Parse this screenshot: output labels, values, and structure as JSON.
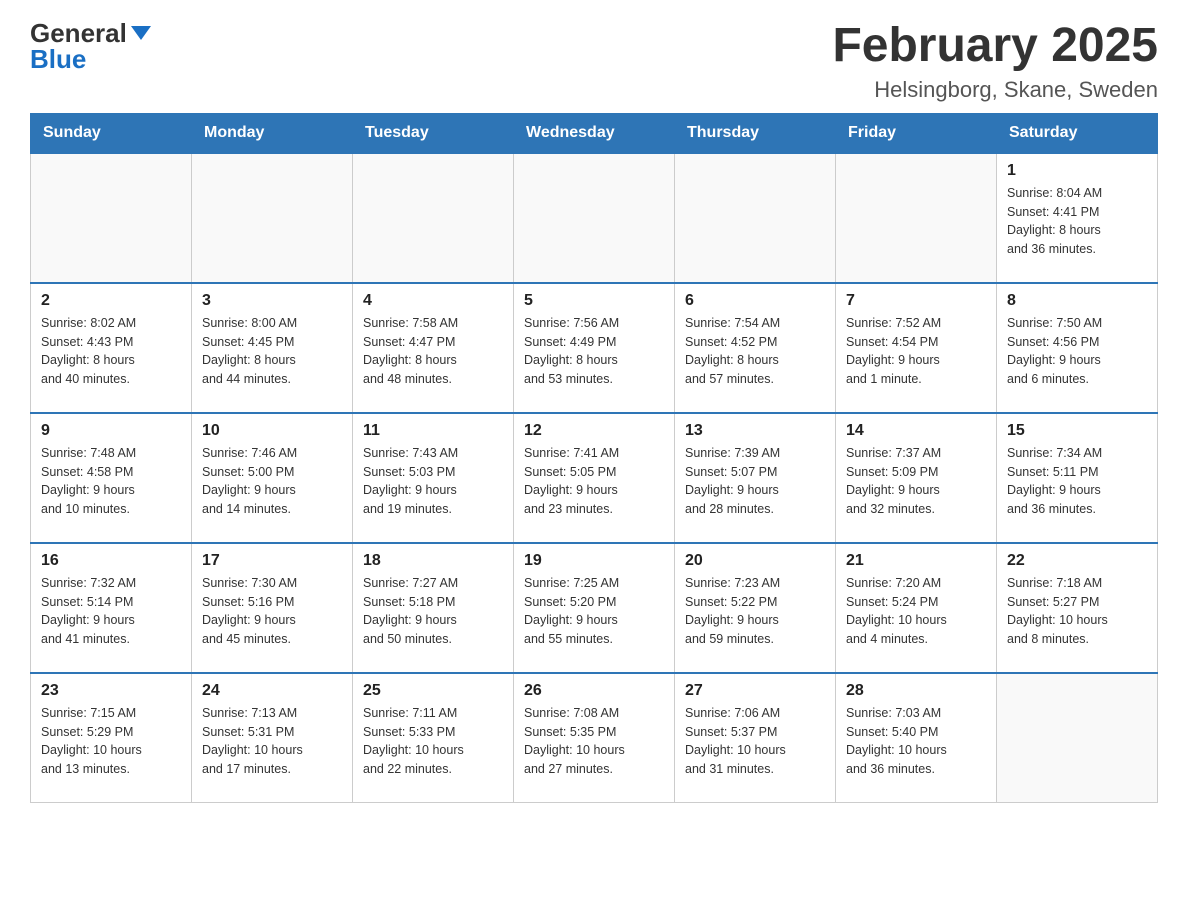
{
  "header": {
    "logo_general": "General",
    "logo_blue": "Blue",
    "month_title": "February 2025",
    "location": "Helsingborg, Skane, Sweden"
  },
  "weekdays": [
    "Sunday",
    "Monday",
    "Tuesday",
    "Wednesday",
    "Thursday",
    "Friday",
    "Saturday"
  ],
  "weeks": [
    [
      {
        "day": "",
        "info": ""
      },
      {
        "day": "",
        "info": ""
      },
      {
        "day": "",
        "info": ""
      },
      {
        "day": "",
        "info": ""
      },
      {
        "day": "",
        "info": ""
      },
      {
        "day": "",
        "info": ""
      },
      {
        "day": "1",
        "info": "Sunrise: 8:04 AM\nSunset: 4:41 PM\nDaylight: 8 hours\nand 36 minutes."
      }
    ],
    [
      {
        "day": "2",
        "info": "Sunrise: 8:02 AM\nSunset: 4:43 PM\nDaylight: 8 hours\nand 40 minutes."
      },
      {
        "day": "3",
        "info": "Sunrise: 8:00 AM\nSunset: 4:45 PM\nDaylight: 8 hours\nand 44 minutes."
      },
      {
        "day": "4",
        "info": "Sunrise: 7:58 AM\nSunset: 4:47 PM\nDaylight: 8 hours\nand 48 minutes."
      },
      {
        "day": "5",
        "info": "Sunrise: 7:56 AM\nSunset: 4:49 PM\nDaylight: 8 hours\nand 53 minutes."
      },
      {
        "day": "6",
        "info": "Sunrise: 7:54 AM\nSunset: 4:52 PM\nDaylight: 8 hours\nand 57 minutes."
      },
      {
        "day": "7",
        "info": "Sunrise: 7:52 AM\nSunset: 4:54 PM\nDaylight: 9 hours\nand 1 minute."
      },
      {
        "day": "8",
        "info": "Sunrise: 7:50 AM\nSunset: 4:56 PM\nDaylight: 9 hours\nand 6 minutes."
      }
    ],
    [
      {
        "day": "9",
        "info": "Sunrise: 7:48 AM\nSunset: 4:58 PM\nDaylight: 9 hours\nand 10 minutes."
      },
      {
        "day": "10",
        "info": "Sunrise: 7:46 AM\nSunset: 5:00 PM\nDaylight: 9 hours\nand 14 minutes."
      },
      {
        "day": "11",
        "info": "Sunrise: 7:43 AM\nSunset: 5:03 PM\nDaylight: 9 hours\nand 19 minutes."
      },
      {
        "day": "12",
        "info": "Sunrise: 7:41 AM\nSunset: 5:05 PM\nDaylight: 9 hours\nand 23 minutes."
      },
      {
        "day": "13",
        "info": "Sunrise: 7:39 AM\nSunset: 5:07 PM\nDaylight: 9 hours\nand 28 minutes."
      },
      {
        "day": "14",
        "info": "Sunrise: 7:37 AM\nSunset: 5:09 PM\nDaylight: 9 hours\nand 32 minutes."
      },
      {
        "day": "15",
        "info": "Sunrise: 7:34 AM\nSunset: 5:11 PM\nDaylight: 9 hours\nand 36 minutes."
      }
    ],
    [
      {
        "day": "16",
        "info": "Sunrise: 7:32 AM\nSunset: 5:14 PM\nDaylight: 9 hours\nand 41 minutes."
      },
      {
        "day": "17",
        "info": "Sunrise: 7:30 AM\nSunset: 5:16 PM\nDaylight: 9 hours\nand 45 minutes."
      },
      {
        "day": "18",
        "info": "Sunrise: 7:27 AM\nSunset: 5:18 PM\nDaylight: 9 hours\nand 50 minutes."
      },
      {
        "day": "19",
        "info": "Sunrise: 7:25 AM\nSunset: 5:20 PM\nDaylight: 9 hours\nand 55 minutes."
      },
      {
        "day": "20",
        "info": "Sunrise: 7:23 AM\nSunset: 5:22 PM\nDaylight: 9 hours\nand 59 minutes."
      },
      {
        "day": "21",
        "info": "Sunrise: 7:20 AM\nSunset: 5:24 PM\nDaylight: 10 hours\nand 4 minutes."
      },
      {
        "day": "22",
        "info": "Sunrise: 7:18 AM\nSunset: 5:27 PM\nDaylight: 10 hours\nand 8 minutes."
      }
    ],
    [
      {
        "day": "23",
        "info": "Sunrise: 7:15 AM\nSunset: 5:29 PM\nDaylight: 10 hours\nand 13 minutes."
      },
      {
        "day": "24",
        "info": "Sunrise: 7:13 AM\nSunset: 5:31 PM\nDaylight: 10 hours\nand 17 minutes."
      },
      {
        "day": "25",
        "info": "Sunrise: 7:11 AM\nSunset: 5:33 PM\nDaylight: 10 hours\nand 22 minutes."
      },
      {
        "day": "26",
        "info": "Sunrise: 7:08 AM\nSunset: 5:35 PM\nDaylight: 10 hours\nand 27 minutes."
      },
      {
        "day": "27",
        "info": "Sunrise: 7:06 AM\nSunset: 5:37 PM\nDaylight: 10 hours\nand 31 minutes."
      },
      {
        "day": "28",
        "info": "Sunrise: 7:03 AM\nSunset: 5:40 PM\nDaylight: 10 hours\nand 36 minutes."
      },
      {
        "day": "",
        "info": ""
      }
    ]
  ]
}
